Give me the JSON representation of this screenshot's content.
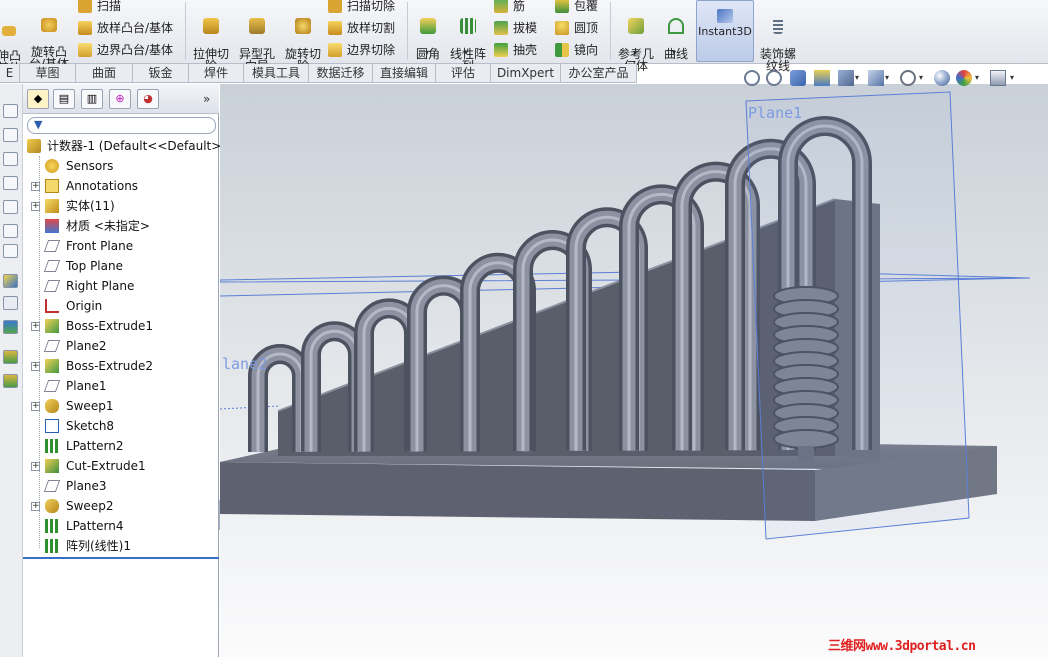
{
  "ribbon": {
    "left_label": "伸凸\n基体",
    "revolve_boss": "旋转凸\n台/基体",
    "sweep": "扫描",
    "loft_boss": "放样凸台/基体",
    "boundary_boss": "边界凸台/基体",
    "extrude_cut": "拉伸切\n除",
    "hole_wizard": "异型孔\n向导",
    "revolve_cut": "旋转切\n除",
    "swept_cut": "扫描切除",
    "lofted_cut": "放样切割",
    "boundary_cut": "边界切除",
    "fillet": "圆角",
    "linear_pattern": "线性阵\n列",
    "rib": "筋",
    "draft": "拔模",
    "shell": "抽壳",
    "wrap": "包覆",
    "dome": "圆顶",
    "mirror": "镜向",
    "ref_geometry": "参考几\n何体",
    "curves": "曲线",
    "instant3d": "Instant3D",
    "cosmetic_thread": "装饰螺\n纹线"
  },
  "tabs": [
    "E",
    "草图",
    "曲面",
    "钣金",
    "焊件",
    "模具工具",
    "数据迁移",
    "直接编辑",
    "评估",
    "DimXpert",
    "办公室产品"
  ],
  "tree": {
    "root": "计数器-1  (Default<<Default>_",
    "nodes": [
      {
        "label": "Sensors",
        "icon": "sensors-icon",
        "expand": false
      },
      {
        "label": "Annotations",
        "icon": "annotations-icon",
        "expand": true
      },
      {
        "label": "实体(11)",
        "icon": "solid-bodies-icon",
        "expand": true
      },
      {
        "label": "材质 <未指定>",
        "icon": "material-icon",
        "expand": false
      },
      {
        "label": "Front Plane",
        "icon": "plane-icon",
        "expand": false
      },
      {
        "label": "Top Plane",
        "icon": "plane-icon",
        "expand": false
      },
      {
        "label": "Right Plane",
        "icon": "plane-icon",
        "expand": false
      },
      {
        "label": "Origin",
        "icon": "origin-icon",
        "expand": false
      },
      {
        "label": "Boss-Extrude1",
        "icon": "boss-extrude-icon",
        "expand": true
      },
      {
        "label": "Plane2",
        "icon": "plane-icon",
        "expand": false
      },
      {
        "label": "Boss-Extrude2",
        "icon": "boss-extrude-icon",
        "expand": true
      },
      {
        "label": "Plane1",
        "icon": "plane-icon",
        "expand": false
      },
      {
        "label": "Sweep1",
        "icon": "sweep-icon",
        "expand": true
      },
      {
        "label": "Sketch8",
        "icon": "sketch-icon",
        "expand": false
      },
      {
        "label": "LPattern2",
        "icon": "linear-pattern-icon",
        "expand": false
      },
      {
        "label": "Cut-Extrude1",
        "icon": "cut-extrude-icon",
        "expand": true
      },
      {
        "label": "Plane3",
        "icon": "plane-icon",
        "expand": false
      },
      {
        "label": "Sweep2",
        "icon": "sweep-icon",
        "expand": true
      },
      {
        "label": "LPattern4",
        "icon": "linear-pattern-icon",
        "expand": false
      },
      {
        "label": "阵列(线性)1",
        "icon": "linear-pattern-icon",
        "expand": false
      }
    ]
  },
  "viewport": {
    "plane_label_1": "Plane1",
    "plane_label_2": "lane2"
  },
  "watermark": "三维网www.3dportal.cn",
  "colors": {
    "plane": "#5b7fd6",
    "part": "#6e7383",
    "ribbon_active": "#bccbe8",
    "watermark": "#e02020"
  }
}
